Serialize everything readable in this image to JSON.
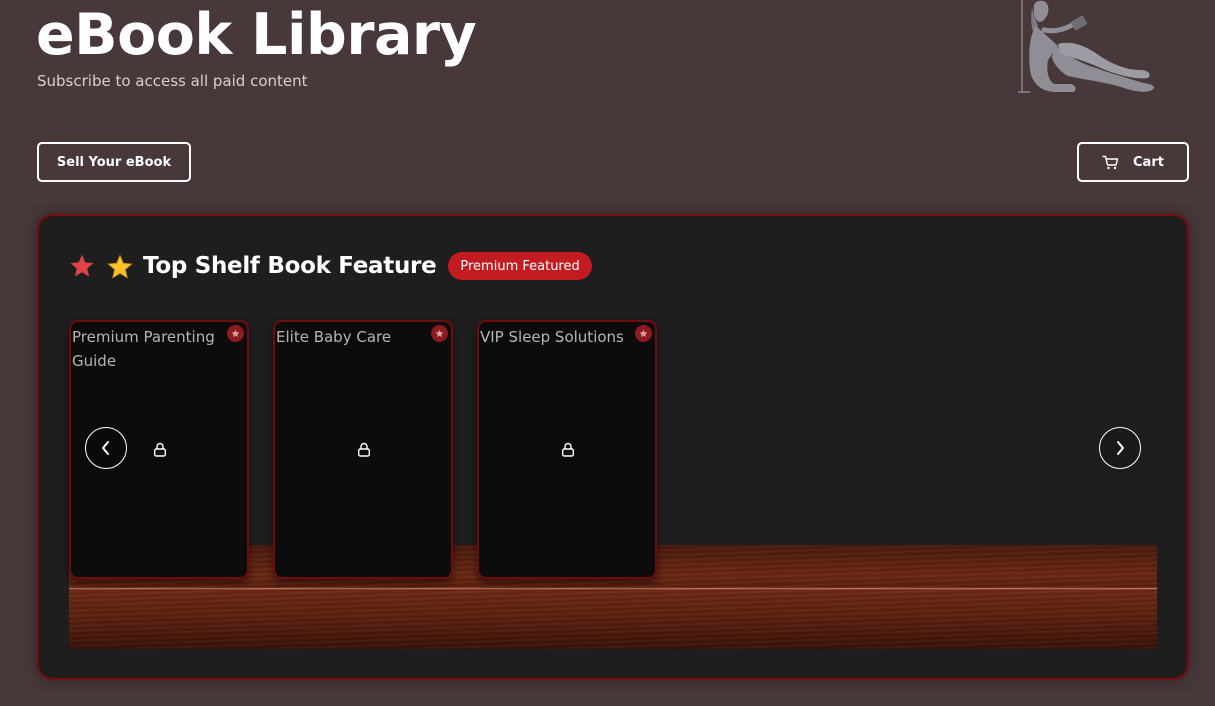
{
  "header": {
    "title": "eBook Library",
    "subtitle": "Subscribe to access all paid content"
  },
  "actions": {
    "sell_label": "Sell Your eBook",
    "cart_label": "Cart"
  },
  "featured": {
    "title": "Top Shelf Book Feature",
    "badge": "Premium Featured",
    "books": [
      {
        "title": "Premium Parenting Guide",
        "locked": true
      },
      {
        "title": "Elite Baby Care",
        "locked": true
      },
      {
        "title": "VIP Sleep Solutions",
        "locked": true
      }
    ]
  },
  "icons": {
    "cart": "cart-icon",
    "prev": "chevron-left-icon",
    "next": "chevron-right-icon",
    "lock": "lock-icon",
    "star": "star-icon"
  },
  "colors": {
    "page_bg": "#48383a",
    "panel_bg": "#1e1e1f",
    "accent": "#c21c22",
    "panel_border": "#7a0a0e"
  }
}
